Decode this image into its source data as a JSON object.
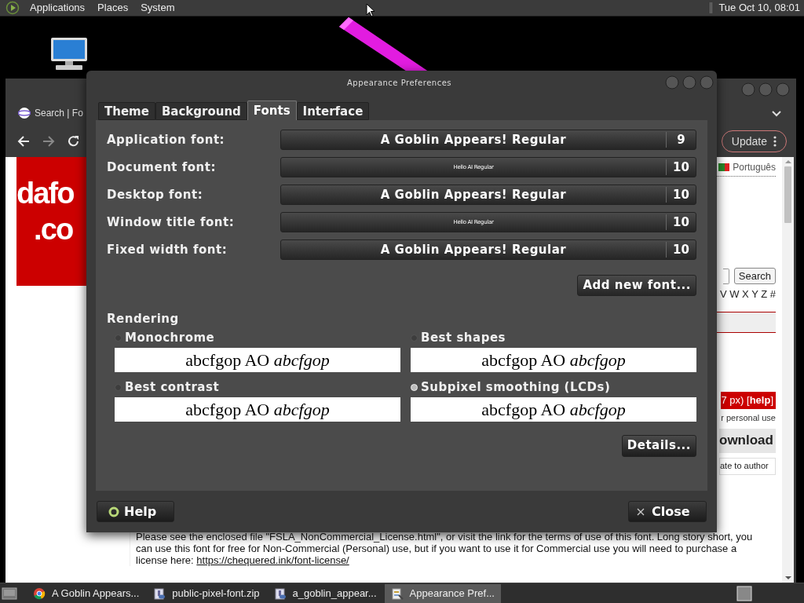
{
  "top_panel": {
    "menus": [
      "Applications",
      "Places",
      "System"
    ],
    "clock": "Tue Oct 10, 08:01"
  },
  "browser": {
    "tab_title": "Search | Fo",
    "update_button": "Update",
    "logo_lines": [
      "dafo",
      ".co"
    ],
    "language": "Português",
    "search_button": "Search",
    "alphabet": "V W X Y Z #",
    "size_notice": "7 px) [**help**]",
    "license_note": "r personal use",
    "download_button": "ownload",
    "donate_button": "ate to author",
    "paragraph": "Please see the enclosed file \"FSLA_NonCommercial_License.html\", or visit the link for the terms of use of this font. Long story short, you can use this font for free for Non-Commercial (Personal) use, but if you want to use it for Commercial use you will need to purchase a license here:",
    "license_link": "https://chequered.ink/font-license/"
  },
  "dialog": {
    "title": "Appearance Preferences",
    "tabs": [
      {
        "label": "Theme",
        "selected": false
      },
      {
        "label": "Background",
        "selected": false
      },
      {
        "label": "Fonts",
        "selected": true
      },
      {
        "label": "Interface",
        "selected": false
      }
    ],
    "font_rows": [
      {
        "label": "Application font:",
        "font": "A Goblin Appears! Regular",
        "size": "9",
        "kind": "large"
      },
      {
        "label": "Document font:",
        "font": "Hello AI Regular",
        "size": "10",
        "kind": "small"
      },
      {
        "label": "Desktop font:",
        "font": "A Goblin Appears! Regular",
        "size": "10",
        "kind": "large"
      },
      {
        "label": "Window title font:",
        "font": "Hello AI Regular",
        "size": "10",
        "kind": "small"
      },
      {
        "label": "Fixed width font:",
        "font": "A Goblin Appears! Regular",
        "size": "10",
        "kind": "large"
      }
    ],
    "add_font_button": "Add new font...",
    "rendering": {
      "heading": "Rendering",
      "options": [
        {
          "label": "Monochrome",
          "selected": false,
          "sample": "abcfgop AO *abcfgop*"
        },
        {
          "label": "Best shapes",
          "selected": false,
          "sample": "abcfgop AO *abcfgop*"
        },
        {
          "label": "Best contrast",
          "selected": false,
          "sample": "abcfgop AO *abcfgop*"
        },
        {
          "label": "Subpixel smoothing (LCDs)",
          "selected": true,
          "sample": "abcfgop AO *abcfgop*"
        }
      ]
    },
    "details_button": "Details...",
    "help_button": "Help",
    "close_button": "Close"
  },
  "taskbar": {
    "items": [
      {
        "label": "A Goblin Appears...",
        "kind": "browser",
        "selected": false
      },
      {
        "label": "public-pixel-font.zip",
        "kind": "archive",
        "selected": false
      },
      {
        "label": "a_goblin_appear...",
        "kind": "archive",
        "selected": false
      },
      {
        "label": "Appearance Pref...",
        "kind": "settings",
        "selected": true
      }
    ]
  }
}
